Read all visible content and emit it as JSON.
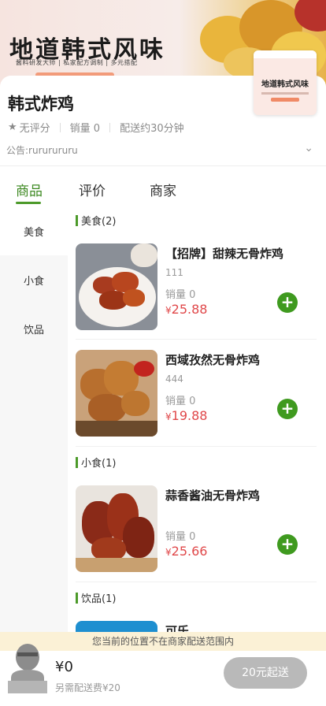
{
  "banner": {
    "title": "地道韩式风味",
    "subtitle": "酱料研发大师 | 私家配方调制 | 多元搭配"
  },
  "shop": {
    "name": "韩式炸鸡",
    "rating": "无评分",
    "sales": "销量 0",
    "delivery_time": "配送约30分钟",
    "notice": "公告:rururururu",
    "thumb_title": "地道韩式风味"
  },
  "tabs": [
    {
      "label": "商品",
      "active": true
    },
    {
      "label": "评价",
      "active": false
    },
    {
      "label": "商家",
      "active": false
    }
  ],
  "categories": [
    {
      "label": "美食",
      "active": true
    },
    {
      "label": "小食",
      "active": false
    },
    {
      "label": "饮品",
      "active": false
    }
  ],
  "sections": [
    {
      "title": "美食(2)"
    },
    {
      "title": "小食(1)"
    },
    {
      "title": "饮品(1)"
    }
  ],
  "goods": [
    {
      "name": "【招牌】甜辣无骨炸鸡",
      "desc": "111",
      "sales": "销量 0",
      "currency": "¥",
      "price": "25.88"
    },
    {
      "name": "西域孜然无骨炸鸡",
      "desc": "444",
      "sales": "销量 0",
      "currency": "¥",
      "price": "19.88"
    },
    {
      "name": "蒜香酱油无骨炸鸡",
      "desc": "",
      "sales": "销量 0",
      "currency": "¥",
      "price": "25.66"
    },
    {
      "name": "可乐",
      "desc": "",
      "sales": "",
      "currency": "",
      "price": ""
    }
  ],
  "add_button_glyph": "+",
  "range_notice": "您当前的位置不在商家配送范围内",
  "cart": {
    "total": "¥0",
    "delivery_fee": "另需配送费¥20",
    "checkout": "20元起送"
  },
  "colors": {
    "accent": "#4c9a2a",
    "price": "#e0484a",
    "checkout_disabled": "#b9b9b9",
    "notice_bg": "#fbf1d6"
  }
}
